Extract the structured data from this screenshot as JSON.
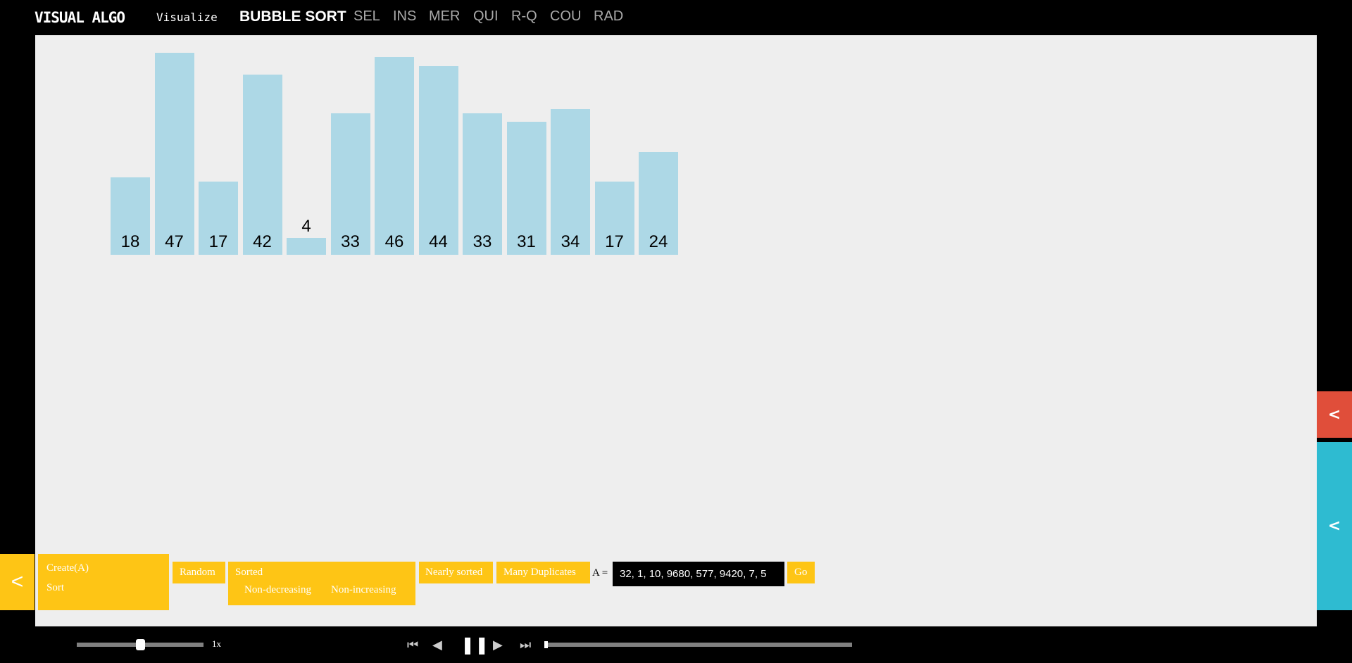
{
  "header": {
    "logo": "VISUAL ALGO",
    "visualize": "Visualize",
    "current": "BUBBLE SORT",
    "algorithms": [
      "SEL",
      "INS",
      "MER",
      "QUI",
      "R-Q",
      "COU",
      "RAD"
    ]
  },
  "chart_data": {
    "type": "bar",
    "values": [
      18,
      47,
      17,
      42,
      4,
      33,
      46,
      44,
      33,
      31,
      34,
      17,
      24
    ],
    "bar_color": "#add8e6"
  },
  "controls": {
    "side_tab": "<",
    "create": "Create(A)",
    "sort": "Sort",
    "random": "Random",
    "sorted": "Sorted",
    "non_decreasing": "Non-decreasing",
    "non_increasing": "Non-increasing",
    "nearly_sorted": "Nearly sorted",
    "many_duplicates": "Many Duplicates",
    "a_label": "A =",
    "array_value": "32, 1, 10, 9680, 577, 9420, 7, 5",
    "go": "Go",
    "accent": "#fec515"
  },
  "side": {
    "red": "<",
    "cyan": "<"
  },
  "playback": {
    "speed": "1x",
    "speed_fraction": 0.5,
    "progress": 0.0
  }
}
